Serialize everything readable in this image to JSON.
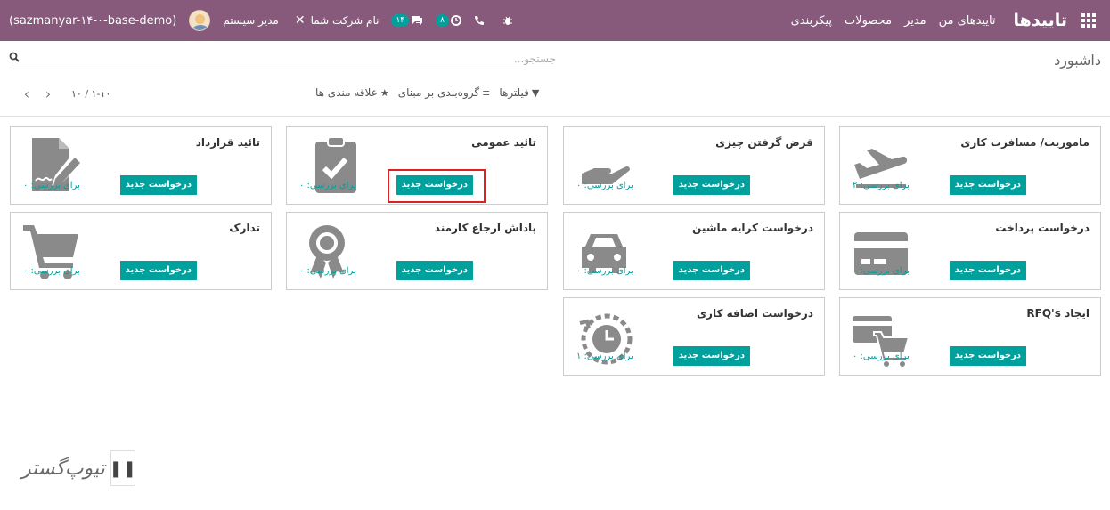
{
  "navbar": {
    "brand": "تاییدها",
    "menu": [
      "تاییدهای من",
      "مدیر",
      "محصولات",
      "پیکربندی"
    ],
    "db_name": "(sazmanyar-۱۴-۰-base-demo)",
    "user_name": "مدیر سیستم",
    "company": "نام شرکت شما",
    "messages_count": "۱۴",
    "activities_count": "۸",
    "color": "#875a7b"
  },
  "control_panel": {
    "breadcrumb": "داشبورد",
    "search_placeholder": "جستجو...",
    "filters_label": "فیلترها",
    "groupby_label": "گروه‌بندی بر مبنای",
    "favorites_label": "علاقه مندی ها",
    "pager_value": "۱-۱۰ / ۱۰"
  },
  "cards": [
    {
      "title": "ماموریت/ مسافرت کاری",
      "button": "درخواست جدید",
      "review": "برای بررسی: ۲",
      "icon": "plane-icon"
    },
    {
      "title": "قرض گرفتن چیزی",
      "button": "درخواست جدید",
      "review": "برای بررسی: ۰",
      "icon": "hand-icon"
    },
    {
      "title": "تائید عمومی",
      "button": "درخواست جدید",
      "review": "برای بررسی: ۰",
      "icon": "clipboard-check-icon"
    },
    {
      "title": "تائید قرارداد",
      "button": "درخواست جدید",
      "review": "برای بررسی: ۰",
      "icon": "contract-sign-icon"
    },
    {
      "title": "درخواست پرداخت",
      "button": "درخواست جدید",
      "review": "برای بررسی: ۰",
      "icon": "credit-card-icon"
    },
    {
      "title": "درخواست کرایه ماشین",
      "button": "درخواست جدید",
      "review": "برای بررسی: ۰",
      "icon": "car-icon"
    },
    {
      "title": "پاداش ارجاع کارمند",
      "button": "درخواست جدید",
      "review": "برای بررسی: ۰",
      "icon": "award-ribbon-icon"
    },
    {
      "title": "تدارک",
      "button": "درخواست جدید",
      "review": "برای بررسی: ۰",
      "icon": "cart-icon"
    },
    {
      "title": "ایجاد RFQ's",
      "button": "درخواست جدید",
      "review": "برای بررسی: ۰",
      "icon": "card-cart-icon"
    },
    {
      "title": "درخواست اضافه کاری",
      "button": "درخواست جدید",
      "review": "برای بررسی: ۱",
      "icon": "clock-history-icon"
    }
  ],
  "colors": {
    "accent": "#00a09d",
    "highlight": "#e02020"
  }
}
